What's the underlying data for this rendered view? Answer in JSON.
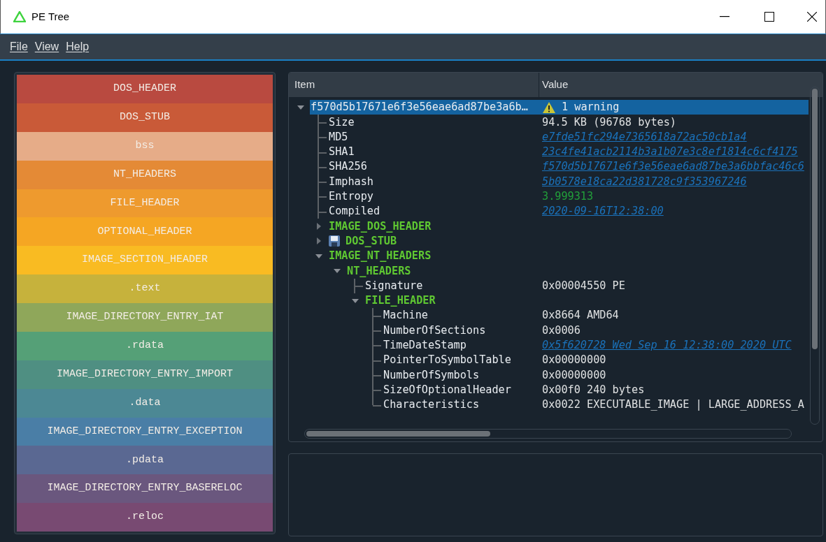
{
  "window": {
    "title": "PE Tree"
  },
  "menu": [
    "File",
    "View",
    "Help"
  ],
  "regions": [
    {
      "label": "DOS_HEADER",
      "color": "#b94a40"
    },
    {
      "label": "DOS_STUB",
      "color": "#c95a38"
    },
    {
      "label": "bss",
      "color": "#e6ac88"
    },
    {
      "label": "NT_HEADERS",
      "color": "#e48a36"
    },
    {
      "label": "FILE_HEADER",
      "color": "#ee9a2e"
    },
    {
      "label": "OPTIONAL_HEADER",
      "color": "#f5a623"
    },
    {
      "label": "IMAGE_SECTION_HEADER",
      "color": "#f9bb22"
    },
    {
      "label": ".text",
      "color": "#c6b23c"
    },
    {
      "label": "IMAGE_DIRECTORY_ENTRY_IAT",
      "color": "#8fa75a"
    },
    {
      "label": ".rdata",
      "color": "#55a077"
    },
    {
      "label": "IMAGE_DIRECTORY_ENTRY_IMPORT",
      "color": "#4f8f82"
    },
    {
      "label": ".data",
      "color": "#4c8894"
    },
    {
      "label": "IMAGE_DIRECTORY_ENTRY_EXCEPTION",
      "color": "#4a7ea6"
    },
    {
      "label": ".pdata",
      "color": "#5a6892"
    },
    {
      "label": "IMAGE_DIRECTORY_ENTRY_BASERELOC",
      "color": "#6a577e"
    },
    {
      "label": ".reloc",
      "color": "#784a72"
    }
  ],
  "tree": {
    "columns": [
      "Item",
      "Value"
    ],
    "nodes": [
      {
        "kind": "root",
        "label": "f570d5b17671e6f3e56eae6ad87be3a6b…",
        "value": "1 warning",
        "expanded": true,
        "selected": true,
        "children": [
          {
            "kind": "field",
            "label": "Size",
            "value": "94.5 KB (96768 bytes)",
            "selected": false
          },
          {
            "kind": "link-field",
            "label": "MD5",
            "value": "e7fde51fc294e7365618a72ac50cb1a4",
            "selected": false
          },
          {
            "kind": "link-field",
            "label": "SHA1",
            "value": "23c4fe41acb2114b3a1b07e3c8ef1814c6cf4175",
            "selected": false
          },
          {
            "kind": "link-field",
            "label": "SHA256",
            "value": "f570d5b17671e6f3e56eae6ad87be3a6bbfac46c6",
            "selected": false
          },
          {
            "kind": "link-field",
            "label": "Imphash",
            "value": "5b0578e18ca22d381728c9f353967246",
            "selected": false
          },
          {
            "kind": "number-field",
            "label": "Entropy",
            "value": "3.999313",
            "selected": false
          },
          {
            "kind": "link-field",
            "label": "Compiled",
            "value": "2020-09-16T12:38:00",
            "selected": false
          },
          {
            "kind": "section",
            "label": "IMAGE_DOS_HEADER",
            "expanded": false,
            "selected": false
          },
          {
            "kind": "blob-section",
            "label": "DOS_STUB",
            "expanded": false,
            "selected": false
          },
          {
            "kind": "section",
            "label": "IMAGE_NT_HEADERS",
            "expanded": true,
            "selected": false,
            "children": [
              {
                "kind": "section",
                "label": "NT_HEADERS",
                "expanded": true,
                "selected": false,
                "children": [
                  {
                    "kind": "field",
                    "label": "Signature",
                    "value": "0x00004550 PE",
                    "selected": false
                  },
                  {
                    "kind": "section",
                    "label": "FILE_HEADER",
                    "expanded": true,
                    "selected": false,
                    "children": [
                      {
                        "kind": "field",
                        "label": "Machine",
                        "value": "0x8664 AMD64",
                        "selected": false
                      },
                      {
                        "kind": "field",
                        "label": "NumberOfSections",
                        "value": "0x0006",
                        "selected": false
                      },
                      {
                        "kind": "link-field",
                        "label": "TimeDateStamp",
                        "value": "0x5f620728 Wed Sep 16 12:38:00 2020 UTC",
                        "selected": false
                      },
                      {
                        "kind": "field",
                        "label": "PointerToSymbolTable",
                        "value": "0x00000000",
                        "selected": false
                      },
                      {
                        "kind": "field",
                        "label": "NumberOfSymbols",
                        "value": "0x00000000",
                        "selected": false
                      },
                      {
                        "kind": "field",
                        "label": "SizeOfOptionalHeader",
                        "value": "0x00f0 240 bytes",
                        "selected": false
                      },
                      {
                        "kind": "field",
                        "label": "Characteristics",
                        "value": "0x0022 EXECUTABLE_IMAGE | LARGE_ADDRESS_A",
                        "selected": false
                      }
                    ]
                  }
                ]
              }
            ]
          }
        ]
      }
    ]
  }
}
